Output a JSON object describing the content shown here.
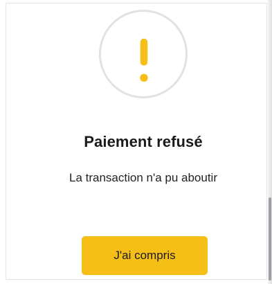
{
  "dialog": {
    "icon": "exclamation-icon",
    "title": "Paiement refusé",
    "message": "La transaction n'a pu aboutir",
    "button_label": "J'ai compris"
  },
  "colors": {
    "accent": "#f6bf17",
    "icon_ring": "#e2e2e6",
    "text": "#1a1a1a"
  }
}
